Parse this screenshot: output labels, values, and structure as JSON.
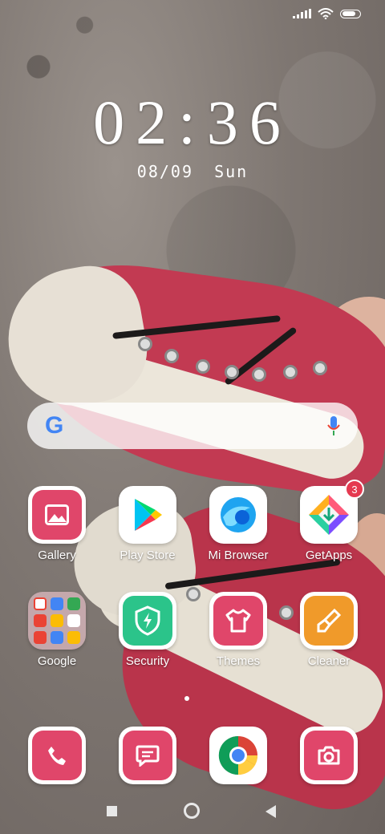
{
  "status": {
    "signal_label": "signal",
    "wifi_label": "wifi",
    "battery_level": 0.78
  },
  "clock": {
    "time": "02:36",
    "date": "08/09",
    "weekday": "Sun"
  },
  "search": {
    "logo": "G"
  },
  "apps": [
    {
      "name": "Gallery",
      "icon": "gallery-icon"
    },
    {
      "name": "Play Store",
      "icon": "play-store-icon"
    },
    {
      "name": "Mi Browser",
      "icon": "mi-browser-icon"
    },
    {
      "name": "GetApps",
      "icon": "getapps-icon",
      "badge": "3"
    },
    {
      "name": "Google",
      "icon": "google-folder-icon"
    },
    {
      "name": "Security",
      "icon": "security-icon"
    },
    {
      "name": "Themes",
      "icon": "themes-icon"
    },
    {
      "name": "Cleaner",
      "icon": "cleaner-icon"
    }
  ],
  "dock": [
    {
      "icon": "phone-icon"
    },
    {
      "icon": "messages-icon"
    },
    {
      "icon": "chrome-icon"
    },
    {
      "icon": "camera-icon"
    }
  ],
  "colors": {
    "accent_pink": "#e0466a",
    "security_green": "#2bc48a",
    "cleaner_orange": "#f09a2a"
  }
}
